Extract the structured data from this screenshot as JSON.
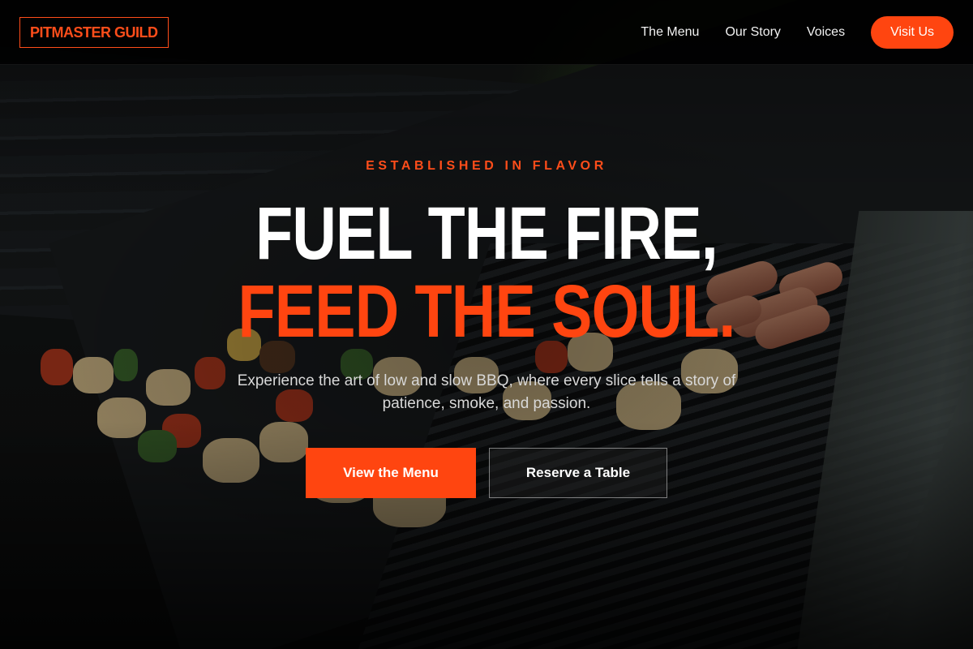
{
  "header": {
    "logo": "PITMASTER GUILD",
    "nav": [
      {
        "label": "The Menu"
      },
      {
        "label": "Our Story"
      },
      {
        "label": "Voices"
      }
    ],
    "cta_label": "Visit Us"
  },
  "hero": {
    "eyebrow": "ESTABLISHED IN FLAVOR",
    "headline_line1": "FUEL THE FIRE,",
    "headline_line2": "FEED THE SOUL.",
    "subtitle": "Experience the art of low and slow BBQ, where every slice tells a story of patience, smoke, and passion.",
    "primary_button": "View the Menu",
    "secondary_button": "Reserve a Table"
  },
  "colors": {
    "accent": "#ff4510",
    "header_bg": "#000000",
    "text": "#ffffff"
  }
}
